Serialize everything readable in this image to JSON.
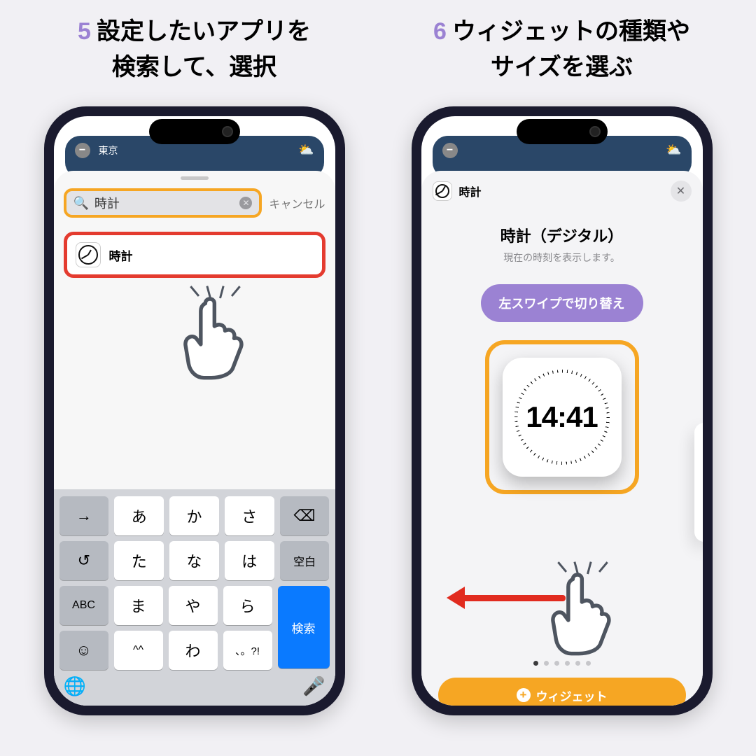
{
  "step5": {
    "num": "5",
    "title_line1": "設定したいアプリを",
    "title_line2": "検索して、選択",
    "bg_city": "東京",
    "search_value": "時計",
    "cancel": "キャンセル",
    "result_label": "時計",
    "keyboard": {
      "row1": [
        "→",
        "あ",
        "か",
        "さ",
        "⌫"
      ],
      "row2": [
        "↺",
        "た",
        "な",
        "は",
        "空白"
      ],
      "row3_left": "ABC",
      "row3_mid": [
        "ま",
        "や",
        "ら"
      ],
      "row3_right": "検索",
      "row4": [
        "☺",
        "^^",
        "わ",
        "、。?!"
      ]
    }
  },
  "step6": {
    "num": "6",
    "title_line1": "ウィジェットの種類や",
    "title_line2": "サイズを選ぶ",
    "picker_app": "時計",
    "widget_title": "時計（デジタル）",
    "widget_sub": "現在の時刻を表示します。",
    "hint": "左スワイプで切り替え",
    "time": "14:41",
    "add_label": "ウィジェット",
    "page_count": 6,
    "active_page": 0
  }
}
